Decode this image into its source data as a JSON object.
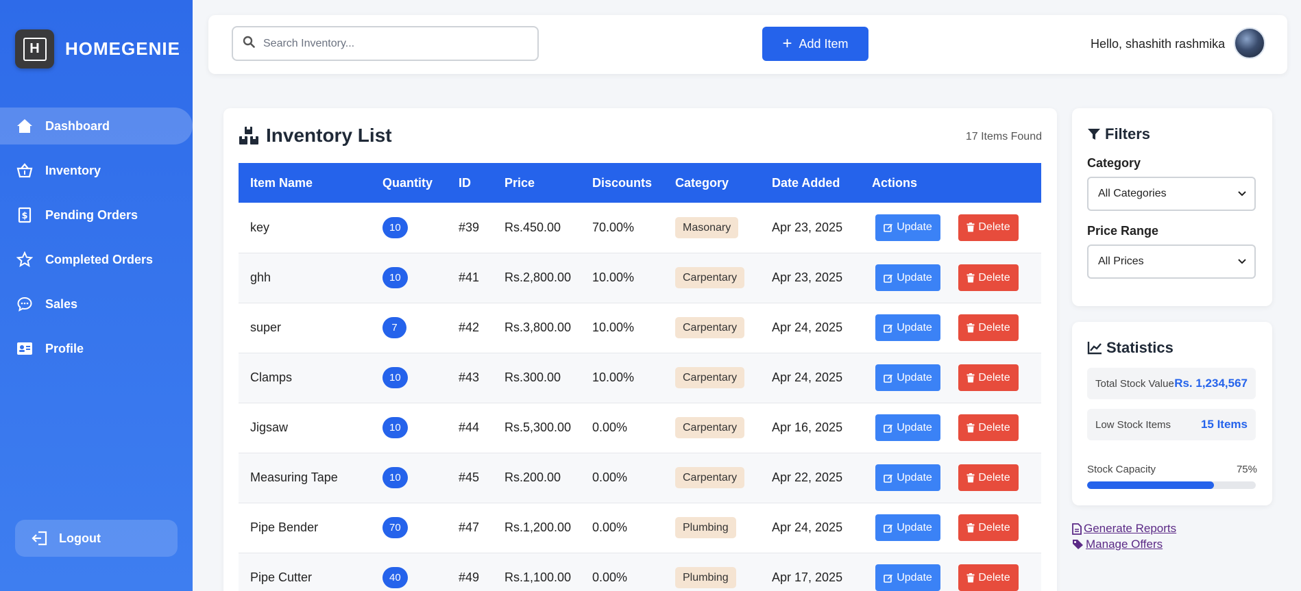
{
  "brand": {
    "name": "HOMEGENIE",
    "logo_letter": "H"
  },
  "nav": {
    "items": [
      {
        "label": "Dashboard",
        "icon": "home-icon",
        "active": true
      },
      {
        "label": "Inventory",
        "icon": "basket-icon",
        "active": false
      },
      {
        "label": "Pending Orders",
        "icon": "receipt-icon",
        "active": false
      },
      {
        "label": "Completed Orders",
        "icon": "star-icon",
        "active": false
      },
      {
        "label": "Sales",
        "icon": "chat-icon",
        "active": false
      },
      {
        "label": "Profile",
        "icon": "id-card-icon",
        "active": false
      }
    ],
    "logout_label": "Logout"
  },
  "topbar": {
    "search_placeholder": "Search Inventory...",
    "add_label": "Add Item",
    "greeting": "Hello, shashith rashmika"
  },
  "inventory": {
    "title": "Inventory List",
    "count_text": "17 Items Found",
    "columns": [
      "Item Name",
      "Quantity",
      "ID",
      "Price",
      "Discounts",
      "Category",
      "Date Added",
      "Actions"
    ],
    "update_label": "Update",
    "delete_label": "Delete",
    "rows": [
      {
        "name": "key",
        "qty": "10",
        "id": "#39",
        "price": "Rs.450.00",
        "discount": "70.00%",
        "category": "Masonary",
        "date": "Apr 23, 2025"
      },
      {
        "name": "ghh",
        "qty": "10",
        "id": "#41",
        "price": "Rs.2,800.00",
        "discount": "10.00%",
        "category": "Carpentary",
        "date": "Apr 23, 2025"
      },
      {
        "name": "super",
        "qty": "7",
        "id": "#42",
        "price": "Rs.3,800.00",
        "discount": "10.00%",
        "category": "Carpentary",
        "date": "Apr 24, 2025"
      },
      {
        "name": "Clamps",
        "qty": "10",
        "id": "#43",
        "price": "Rs.300.00",
        "discount": "10.00%",
        "category": "Carpentary",
        "date": "Apr 24, 2025"
      },
      {
        "name": "Jigsaw",
        "qty": "10",
        "id": "#44",
        "price": "Rs.5,300.00",
        "discount": "0.00%",
        "category": "Carpentary",
        "date": "Apr 16, 2025"
      },
      {
        "name": "Measuring Tape",
        "qty": "10",
        "id": "#45",
        "price": "Rs.200.00",
        "discount": "0.00%",
        "category": "Carpentary",
        "date": "Apr 22, 2025"
      },
      {
        "name": "Pipe Bender",
        "qty": "70",
        "id": "#47",
        "price": "Rs.1,200.00",
        "discount": "0.00%",
        "category": "Plumbing",
        "date": "Apr 24, 2025"
      },
      {
        "name": "Pipe Cutter",
        "qty": "40",
        "id": "#49",
        "price": "Rs.1,100.00",
        "discount": "0.00%",
        "category": "Plumbing",
        "date": "Apr 17, 2025"
      }
    ]
  },
  "filters": {
    "title": "Filters",
    "category_label": "Category",
    "category_value": "All Categories",
    "price_label": "Price Range",
    "price_value": "All Prices"
  },
  "stats": {
    "title": "Statistics",
    "total_label": "Total Stock Value",
    "total_value": "Rs. 1,234,567",
    "low_label": "Low Stock Items",
    "low_value": "15 Items",
    "capacity_label": "Stock Capacity",
    "capacity_text": "75%",
    "capacity_fraction": 0.75
  },
  "links": {
    "reports": "Generate Reports",
    "offers": "Manage Offers"
  },
  "colors": {
    "accent": "#2563eb",
    "danger": "#e74c3c",
    "category_bg": "#f5e4d2"
  }
}
